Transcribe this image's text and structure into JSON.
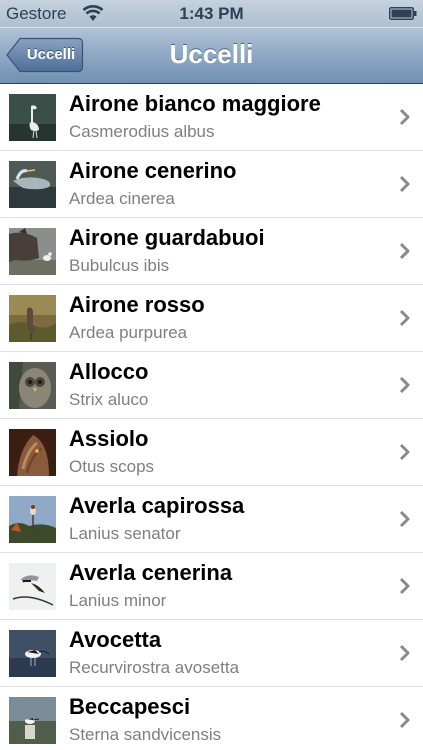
{
  "status_bar": {
    "carrier": "Gestore",
    "time": "1:43 PM",
    "wifi_icon": "wifi-icon",
    "battery_icon": "battery-icon"
  },
  "nav_bar": {
    "title": "Uccelli",
    "back_label": "Uccelli"
  },
  "birds": [
    {
      "name": "Airone bianco maggiore",
      "latin": "Casmerodius albus",
      "thumb": "great-egret-photo"
    },
    {
      "name": "Airone cenerino",
      "latin": "Ardea cinerea",
      "thumb": "grey-heron-photo"
    },
    {
      "name": "Airone guardabuoi",
      "latin": "Bubulcus ibis",
      "thumb": "cattle-egret-photo"
    },
    {
      "name": "Airone rosso",
      "latin": "Ardea purpurea",
      "thumb": "purple-heron-photo"
    },
    {
      "name": "Allocco",
      "latin": "Strix aluco",
      "thumb": "tawny-owl-photo"
    },
    {
      "name": "Assiolo",
      "latin": "Otus scops",
      "thumb": "scops-owl-photo"
    },
    {
      "name": "Averla capirossa",
      "latin": "Lanius senator",
      "thumb": "woodchat-shrike-photo"
    },
    {
      "name": "Averla cenerina",
      "latin": "Lanius minor",
      "thumb": "lesser-grey-shrike-photo"
    },
    {
      "name": "Avocetta",
      "latin": "Recurvirostra avosetta",
      "thumb": "avocet-photo"
    },
    {
      "name": "Beccapesci",
      "latin": "Sterna sandvicensis",
      "thumb": "sandwich-tern-photo"
    }
  ],
  "colors": {
    "nav_gradient_top": "#b3c4d8",
    "nav_gradient_bottom": "#7390b1",
    "subtitle": "#7f7f7f",
    "chevron": "#8a8a8a"
  }
}
